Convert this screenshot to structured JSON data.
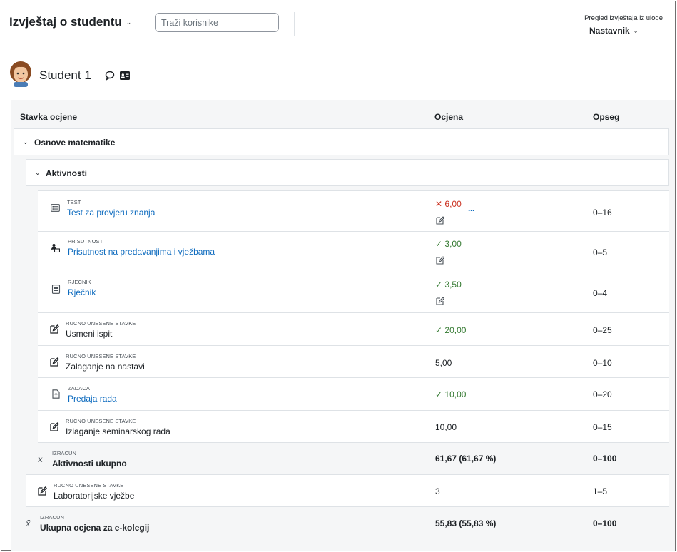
{
  "header": {
    "title": "Izvještaj o studentu",
    "search_placeholder": "Traži korisnike",
    "role_label": "Pregled izvještaja iz uloge",
    "role_value": "Nastavnik"
  },
  "user": {
    "name": "Student 1"
  },
  "columns": {
    "item": "Stavka ocjene",
    "grade": "Ocjena",
    "range": "Opseg"
  },
  "categories": {
    "course": "Osnove matematike",
    "activities": "Aktivnosti"
  },
  "rows": [
    {
      "type": "TEST",
      "name": "Test za provjeru znanja",
      "grade": "6,00",
      "status": "fail",
      "range": "0–16",
      "icon": "quiz-icon"
    },
    {
      "type": "PRISUTNOST",
      "name": "Prisutnost na predavanjima i vježbama",
      "grade": "3,00",
      "status": "pass",
      "range": "0–5",
      "icon": "attendance-icon"
    },
    {
      "type": "RJECNIK",
      "name": "Rječnik",
      "grade": "3,50",
      "status": "pass",
      "range": "0–4",
      "icon": "glossary-icon"
    },
    {
      "type": "RUCNO UNESENE STAVKE",
      "name": "Usmeni ispit",
      "grade": "20,00",
      "status": "pass",
      "range": "0–25",
      "icon": "manual-item-icon"
    },
    {
      "type": "RUCNO UNESENE STAVKE",
      "name": "Zalaganje na nastavi",
      "grade": "5,00",
      "status": "",
      "range": "0–10",
      "icon": "manual-item-icon"
    },
    {
      "type": "ZADACA",
      "name": "Predaja rada",
      "grade": "10,00",
      "status": "pass",
      "range": "0–20",
      "icon": "assignment-icon"
    },
    {
      "type": "RUCNO UNESENE STAVKE",
      "name": "Izlaganje seminarskog rada",
      "grade": "10,00",
      "status": "",
      "range": "0–15",
      "icon": "manual-item-icon"
    }
  ],
  "activities_total": {
    "type": "IZRACUN",
    "name": "Aktivnosti ukupno",
    "grade": "61,67 (61,67 %)",
    "range": "0–100"
  },
  "lab_row": {
    "type": "RUCNO UNESENE STAVKE",
    "name": "Laboratorijske vježbe",
    "grade": "3",
    "range": "1–5"
  },
  "course_total": {
    "type": "IZRACUN",
    "name": "Ukupna ocjena za e-kolegij",
    "grade": "55,83 (55,83 %)",
    "range": "0–100"
  },
  "colors": {
    "link": "#0f6cbf",
    "fail": "#ca3120",
    "pass": "#357a32"
  }
}
